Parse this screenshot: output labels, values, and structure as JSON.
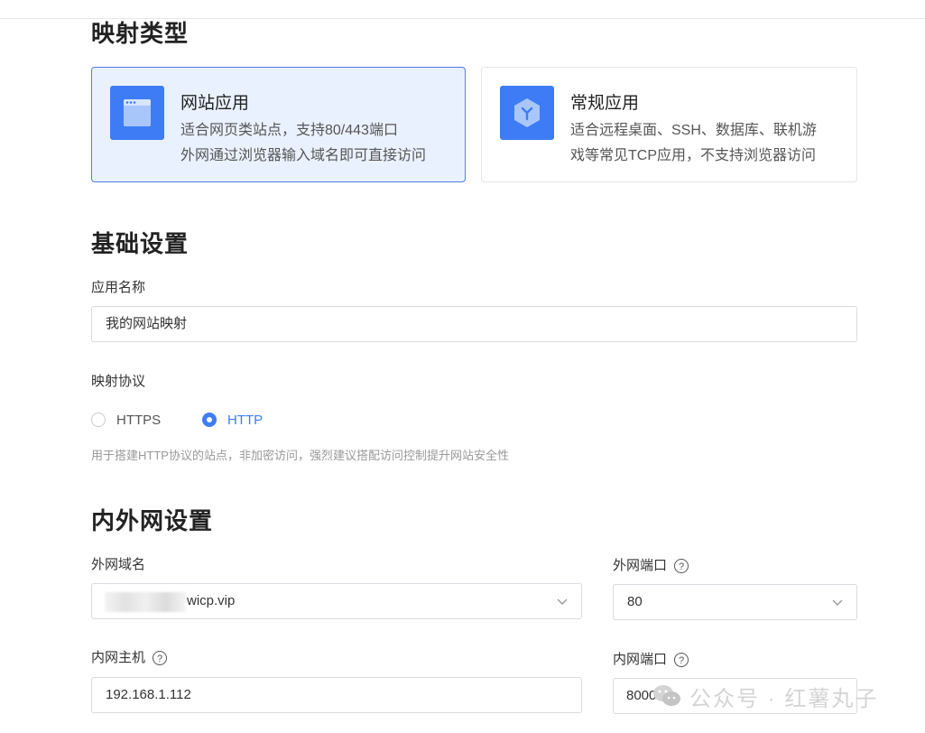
{
  "sections": {
    "mapping_type": "映射类型",
    "basic": "基础设置",
    "network": "内外网设置"
  },
  "cards": [
    {
      "title": "网站应用",
      "desc_line1": "适合网页类站点，支持80/443端口",
      "desc_line2": "外网通过浏览器输入域名即可直接访问",
      "icon": "browser-window-icon",
      "selected": true
    },
    {
      "title": "常规应用",
      "desc_line1": "适合远程桌面、SSH、数据库、联机游",
      "desc_line2": "戏等常见TCP应用，不支持浏览器访问",
      "icon": "cube-icon",
      "selected": false
    }
  ],
  "basic": {
    "app_name_label": "应用名称",
    "app_name_value": "我的网站映射",
    "protocol_label": "映射协议",
    "protocol_options": [
      "HTTPS",
      "HTTP"
    ],
    "protocol_selected": "HTTP",
    "protocol_hint": "用于搭建HTTP协议的站点，非加密访问，强烈建议搭配访问控制提升网站安全性"
  },
  "network": {
    "external_domain_label": "外网域名",
    "external_domain_value": "wicp.vip",
    "external_port_label": "外网端口",
    "external_port_value": "80",
    "internal_host_label": "内网主机",
    "internal_host_value": "192.168.1.112",
    "internal_port_label": "内网端口",
    "internal_port_value": "8000"
  },
  "help_glyph": "?",
  "watermark": "公众号 · 红薯丸子",
  "colors": {
    "accent": "#3d7cf5",
    "selected_bg": "#eaf1fe",
    "hint": "#999999"
  }
}
